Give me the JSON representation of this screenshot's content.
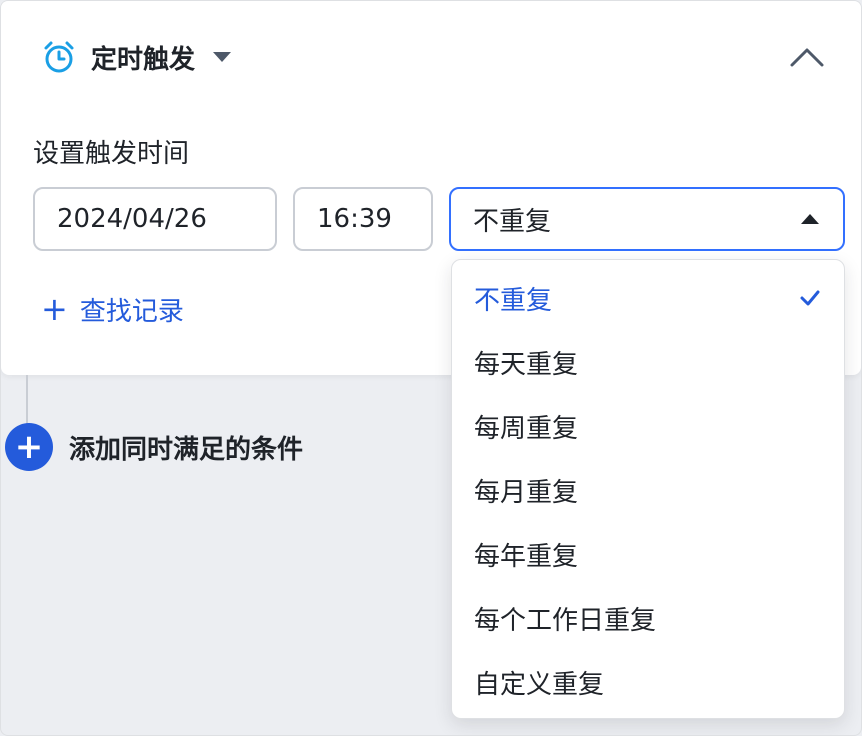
{
  "trigger": {
    "title": "定时触发",
    "icon": "alarm-clock-icon",
    "expand_icon": "caret-down-icon",
    "collapse_icon": "chevron-up-icon"
  },
  "schedule": {
    "label": "设置触发时间",
    "date_value": "2024/04/26",
    "time_value": "16:39",
    "repeat_value": "不重复",
    "repeat_options": [
      {
        "label": "不重复",
        "selected": true
      },
      {
        "label": "每天重复",
        "selected": false
      },
      {
        "label": "每周重复",
        "selected": false
      },
      {
        "label": "每月重复",
        "selected": false
      },
      {
        "label": "每年重复",
        "selected": false
      },
      {
        "label": "每个工作日重复",
        "selected": false
      },
      {
        "label": "自定义重复",
        "selected": false
      }
    ]
  },
  "actions": {
    "add_record_icon": "+",
    "add_record_label": "查找记录",
    "add_condition_icon": "+",
    "add_condition_label": "添加同时满足的条件"
  },
  "colors": {
    "accent": "#245bdb",
    "focus_border": "#3370ff",
    "clock_blue": "#1a9fe5",
    "background": "#eceef2"
  }
}
